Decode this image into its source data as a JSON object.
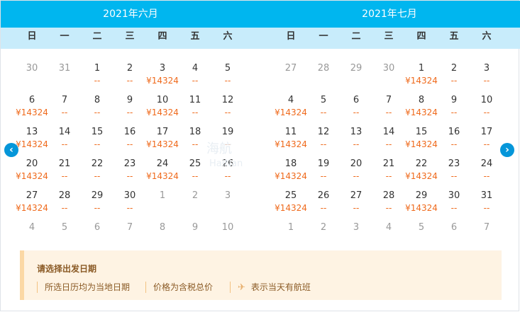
{
  "months": [
    {
      "title": "2021年六月",
      "weekdays": [
        "日",
        "一",
        "二",
        "三",
        "四",
        "五",
        "六"
      ],
      "weeks": [
        [
          {
            "d": "30",
            "p": "",
            "o": true
          },
          {
            "d": "31",
            "p": "",
            "o": true
          },
          {
            "d": "1",
            "p": "--"
          },
          {
            "d": "2",
            "p": "--"
          },
          {
            "d": "3",
            "p": "¥14324"
          },
          {
            "d": "4",
            "p": "--"
          },
          {
            "d": "5",
            "p": "--"
          }
        ],
        [
          {
            "d": "6",
            "p": "¥14324"
          },
          {
            "d": "7",
            "p": "--"
          },
          {
            "d": "8",
            "p": "--"
          },
          {
            "d": "9",
            "p": "--"
          },
          {
            "d": "10",
            "p": "¥14324"
          },
          {
            "d": "11",
            "p": "--"
          },
          {
            "d": "12",
            "p": "--"
          }
        ],
        [
          {
            "d": "13",
            "p": "¥14324"
          },
          {
            "d": "14",
            "p": "--"
          },
          {
            "d": "15",
            "p": "--"
          },
          {
            "d": "16",
            "p": "--"
          },
          {
            "d": "17",
            "p": "¥14324"
          },
          {
            "d": "18",
            "p": "--"
          },
          {
            "d": "19",
            "p": "--"
          }
        ],
        [
          {
            "d": "20",
            "p": "¥14324"
          },
          {
            "d": "21",
            "p": "--"
          },
          {
            "d": "22",
            "p": "--"
          },
          {
            "d": "23",
            "p": "--"
          },
          {
            "d": "24",
            "p": "¥14324"
          },
          {
            "d": "25",
            "p": "--"
          },
          {
            "d": "26",
            "p": "--"
          }
        ],
        [
          {
            "d": "27",
            "p": "¥14324"
          },
          {
            "d": "28",
            "p": "--"
          },
          {
            "d": "29",
            "p": "--"
          },
          {
            "d": "30",
            "p": "--"
          },
          {
            "d": "1",
            "p": "",
            "o": true
          },
          {
            "d": "2",
            "p": "",
            "o": true
          },
          {
            "d": "3",
            "p": "",
            "o": true
          }
        ],
        [
          {
            "d": "4",
            "p": "",
            "o": true
          },
          {
            "d": "5",
            "p": "",
            "o": true
          },
          {
            "d": "6",
            "p": "",
            "o": true
          },
          {
            "d": "7",
            "p": "",
            "o": true
          },
          {
            "d": "8",
            "p": "",
            "o": true
          },
          {
            "d": "9",
            "p": "",
            "o": true
          },
          {
            "d": "10",
            "p": "",
            "o": true
          }
        ]
      ]
    },
    {
      "title": "2021年七月",
      "weekdays": [
        "日",
        "一",
        "二",
        "三",
        "四",
        "五",
        "六"
      ],
      "weeks": [
        [
          {
            "d": "27",
            "p": "",
            "o": true
          },
          {
            "d": "28",
            "p": "",
            "o": true
          },
          {
            "d": "29",
            "p": "",
            "o": true
          },
          {
            "d": "30",
            "p": "",
            "o": true
          },
          {
            "d": "1",
            "p": "¥14324"
          },
          {
            "d": "2",
            "p": "--"
          },
          {
            "d": "3",
            "p": "--"
          }
        ],
        [
          {
            "d": "4",
            "p": "¥14324"
          },
          {
            "d": "5",
            "p": "--"
          },
          {
            "d": "6",
            "p": "--"
          },
          {
            "d": "7",
            "p": "--"
          },
          {
            "d": "8",
            "p": "¥14324"
          },
          {
            "d": "9",
            "p": "--"
          },
          {
            "d": "10",
            "p": "--"
          }
        ],
        [
          {
            "d": "11",
            "p": "¥14324"
          },
          {
            "d": "12",
            "p": "--"
          },
          {
            "d": "13",
            "p": "--"
          },
          {
            "d": "14",
            "p": "--"
          },
          {
            "d": "15",
            "p": "¥14324"
          },
          {
            "d": "16",
            "p": "--"
          },
          {
            "d": "17",
            "p": "--"
          }
        ],
        [
          {
            "d": "18",
            "p": "¥14324"
          },
          {
            "d": "19",
            "p": "--"
          },
          {
            "d": "20",
            "p": "--"
          },
          {
            "d": "21",
            "p": "--"
          },
          {
            "d": "22",
            "p": "¥14324"
          },
          {
            "d": "23",
            "p": "--"
          },
          {
            "d": "24",
            "p": "--"
          }
        ],
        [
          {
            "d": "25",
            "p": "¥14324"
          },
          {
            "d": "26",
            "p": "--"
          },
          {
            "d": "27",
            "p": "--"
          },
          {
            "d": "28",
            "p": "--"
          },
          {
            "d": "29",
            "p": "¥14324"
          },
          {
            "d": "30",
            "p": "--"
          },
          {
            "d": "31",
            "p": "--"
          }
        ],
        [
          {
            "d": "1",
            "p": "",
            "o": true
          },
          {
            "d": "2",
            "p": "",
            "o": true
          },
          {
            "d": "3",
            "p": "",
            "o": true
          },
          {
            "d": "4",
            "p": "",
            "o": true
          },
          {
            "d": "5",
            "p": "",
            "o": true
          },
          {
            "d": "6",
            "p": "",
            "o": true
          },
          {
            "d": "7",
            "p": "",
            "o": true
          }
        ]
      ]
    }
  ],
  "nav": {
    "prev_icon": "chevron-left-icon",
    "next_icon": "chevron-right-icon",
    "prev_glyph": "‹",
    "next_glyph": "›"
  },
  "watermark": {
    "main": "海航",
    "sub": "HaiNan"
  },
  "tips": {
    "title": "请选择出发日期",
    "items": [
      "所选日历均为当地日期",
      "价格为含税总价",
      "表示当天有航班"
    ],
    "flight_icon": "plane-icon",
    "flight_glyph": "✈"
  },
  "colors": {
    "header": "#00b6ef",
    "weekday_bg": "#c8ecfb",
    "price": "#ef6a1c",
    "nav": "#0596d9",
    "tips_bg": "#fef3e3"
  }
}
